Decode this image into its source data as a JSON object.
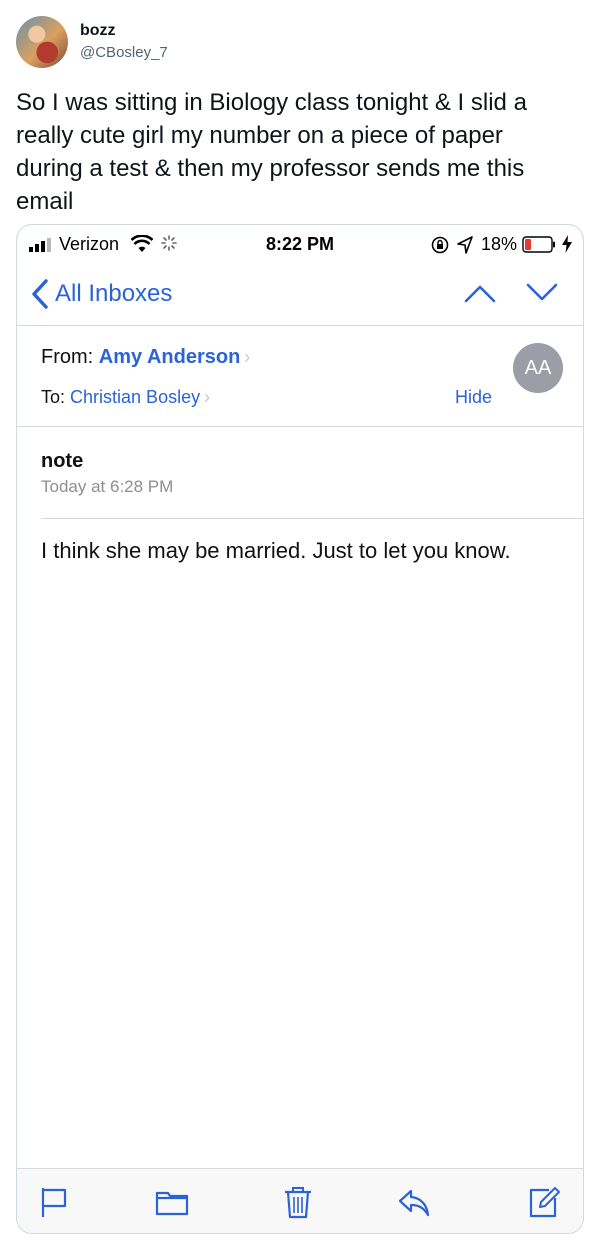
{
  "tweet": {
    "user_name": "bozz",
    "user_handle": "@CBosley_7",
    "text": "So I was sitting in Biology class tonight & I slid a really cute girl my number on a piece of paper during a test & then my professor sends me this email"
  },
  "status_bar": {
    "carrier": "Verizon",
    "time": "8:22 PM",
    "battery": "18%"
  },
  "nav": {
    "back_label": "All Inboxes",
    "icons": [
      "chevron-left-icon",
      "chevron-up-icon",
      "chevron-down-icon"
    ]
  },
  "email": {
    "from_label": "From:",
    "from_name": "Amy Anderson",
    "to_label": "To:",
    "to_name": "Christian Bosley",
    "hide_label": "Hide",
    "avatar_initials": "AA",
    "subject": "note",
    "date": "Today at 6:28 PM",
    "body": "I think she may be married. Just to let you know."
  },
  "toolbar": {
    "icons": [
      "flag-icon",
      "folder-icon",
      "trash-icon",
      "reply-icon",
      "compose-icon"
    ]
  },
  "colors": {
    "accent": "#2b63d6",
    "avatar_gray": "#9b9ea6",
    "secondary_text": "#8e8e93"
  }
}
